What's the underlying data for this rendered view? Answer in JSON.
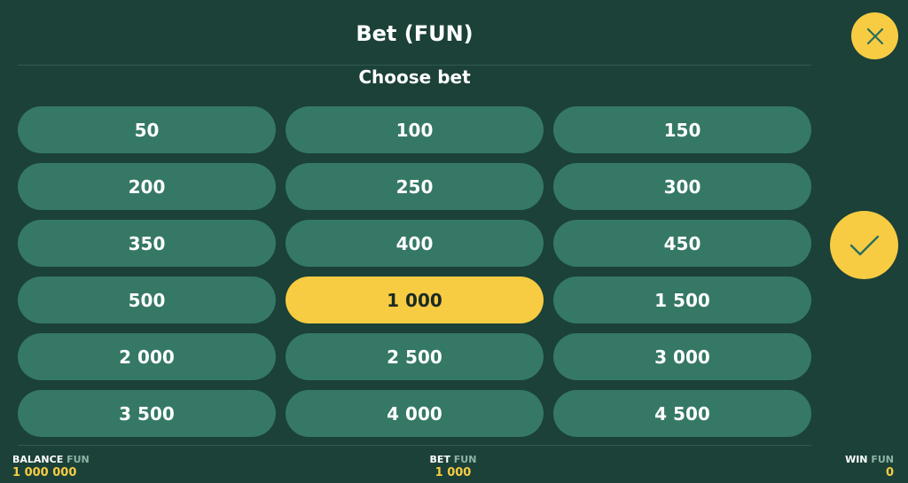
{
  "header": {
    "title": "Bet (FUN)",
    "subtitle": "Choose bet"
  },
  "bets": [
    {
      "label": "50",
      "selected": false
    },
    {
      "label": "100",
      "selected": false
    },
    {
      "label": "150",
      "selected": false
    },
    {
      "label": "200",
      "selected": false
    },
    {
      "label": "250",
      "selected": false
    },
    {
      "label": "300",
      "selected": false
    },
    {
      "label": "350",
      "selected": false
    },
    {
      "label": "400",
      "selected": false
    },
    {
      "label": "450",
      "selected": false
    },
    {
      "label": "500",
      "selected": false
    },
    {
      "label": "1 000",
      "selected": true
    },
    {
      "label": "1 500",
      "selected": false
    },
    {
      "label": "2 000",
      "selected": false
    },
    {
      "label": "2 500",
      "selected": false
    },
    {
      "label": "3 000",
      "selected": false
    },
    {
      "label": "3 500",
      "selected": false
    },
    {
      "label": "4 000",
      "selected": false
    },
    {
      "label": "4 500",
      "selected": false
    }
  ],
  "actions": {
    "close_icon": "close-icon",
    "confirm_icon": "checkmark-icon"
  },
  "footer": {
    "balance": {
      "label": "BALANCE",
      "currency": "FUN",
      "value": "1 000 000"
    },
    "bet": {
      "label": "BET",
      "currency": "FUN",
      "value": "1 000"
    },
    "win": {
      "label": "WIN",
      "currency": "FUN",
      "value": "0"
    }
  },
  "colors": {
    "background": "#1b4138",
    "button": "#357865",
    "accent": "#f7cc43",
    "divider": "#2f5b50"
  }
}
